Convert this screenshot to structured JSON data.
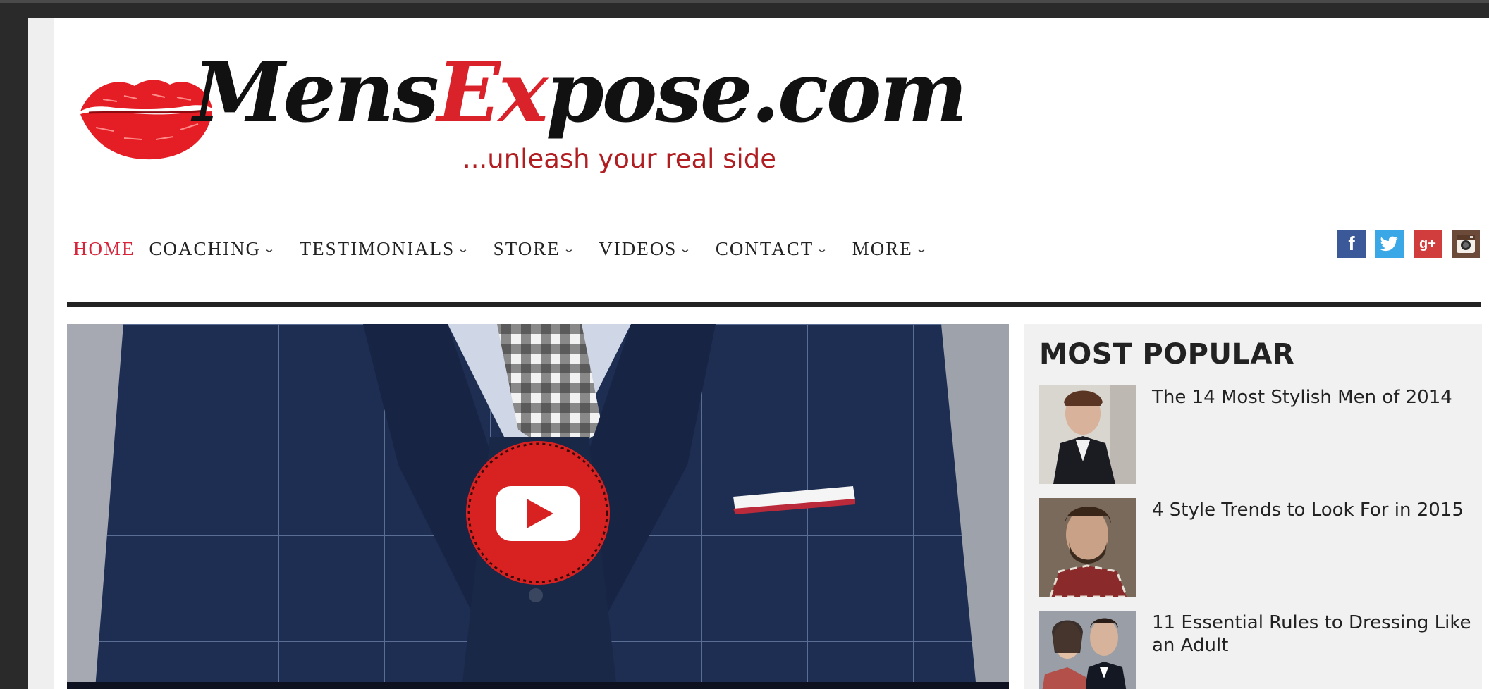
{
  "logo": {
    "word_part1": "Mens",
    "word_part2": "Ex",
    "word_part3": "pose.com",
    "tagline": "...unleash your real side"
  },
  "nav": {
    "items": [
      {
        "label": "HOME",
        "active": true,
        "has_dropdown": false
      },
      {
        "label": "COACHING",
        "active": false,
        "has_dropdown": true
      },
      {
        "label": "TESTIMONIALS",
        "active": false,
        "has_dropdown": true
      },
      {
        "label": "STORE",
        "active": false,
        "has_dropdown": true
      },
      {
        "label": "VIDEOS",
        "active": false,
        "has_dropdown": true
      },
      {
        "label": "CONTACT",
        "active": false,
        "has_dropdown": true
      },
      {
        "label": "MORE",
        "active": false,
        "has_dropdown": true
      }
    ],
    "chevron": "⌄"
  },
  "social": [
    {
      "icon": "facebook-icon",
      "glyph": "f",
      "color": "#3b5998"
    },
    {
      "icon": "twitter-icon",
      "glyph": "",
      "color": "#3aa8e6"
    },
    {
      "icon": "google-plus-icon",
      "glyph": "g+",
      "color": "#d13c3c"
    },
    {
      "icon": "instagram-icon",
      "glyph": "",
      "color": "#6b4a3a"
    }
  ],
  "hero": {
    "icon": "youtube-play-icon"
  },
  "sidebar": {
    "title": "MOST POPULAR",
    "items": [
      {
        "title": "The 14 Most Stylish Men of 2014"
      },
      {
        "title": "4 Style Trends to Look For in 2015"
      },
      {
        "title": "11 Essential Rules to Dressing Like an Adult"
      }
    ]
  },
  "colors": {
    "accent_red": "#d6243b",
    "tagline_red": "#b01e22",
    "rule": "#222222",
    "sidebar_bg": "#f1f1f1"
  }
}
